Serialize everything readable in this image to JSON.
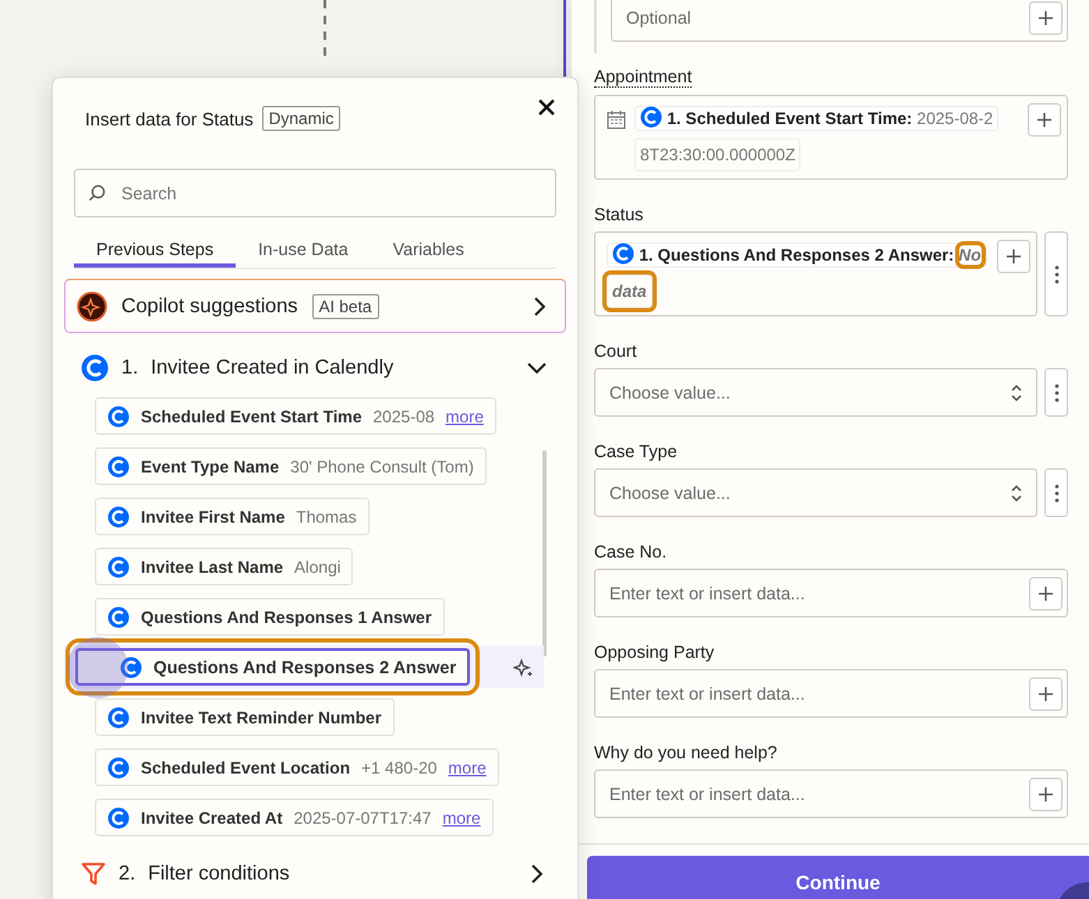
{
  "popup": {
    "title": "Insert data for Status",
    "badge": "Dynamic",
    "search": {
      "placeholder": "Search"
    },
    "tabs": [
      {
        "label": "Previous Steps",
        "selected": true
      },
      {
        "label": "In-use Data",
        "selected": false
      },
      {
        "label": "Variables",
        "selected": false
      }
    ],
    "copilot": {
      "title": "Copilot suggestions",
      "badge": "AI beta"
    },
    "steps": [
      {
        "kind": "calendly",
        "number": "1.",
        "title": "Invitee Created in Calendly",
        "expanded": true,
        "items": [
          {
            "label": "Scheduled Event Start Time",
            "value": "2025-08",
            "link": "more",
            "selected": false
          },
          {
            "label": "Event Type Name",
            "value": "30' Phone Consult (Tom)",
            "selected": false
          },
          {
            "label": "Invitee First Name",
            "value": "Thomas",
            "selected": false
          },
          {
            "label": "Invitee Last Name",
            "value": "Alongi",
            "selected": false
          },
          {
            "label": "Questions And Responses 1 Answer",
            "selected": false
          },
          {
            "label": "Questions And Responses 2 Answer",
            "selected": true
          },
          {
            "label": "Invitee Text Reminder Number",
            "selected": false
          },
          {
            "label": "Scheduled Event Location",
            "value": "+1 480-20",
            "link": "more",
            "selected": false
          },
          {
            "label": "Invitee Created At",
            "value": "2025-07-07T17:47",
            "link": "more",
            "selected": false
          }
        ]
      },
      {
        "kind": "filter",
        "number": "2.",
        "title": "Filter conditions",
        "expanded": false
      }
    ]
  },
  "form": {
    "fields": [
      {
        "kind": "input",
        "placeholder": "Optional",
        "menu": false
      },
      {
        "kind": "token",
        "label": "Appointment",
        "underlined": true,
        "calendar": true,
        "token": "1. Scheduled Event Start Time:",
        "value_parts": [
          {
            "text": "2025-08-2",
            "highlighted": false
          },
          {
            "text": "8T23:30:00.000000Z",
            "highlighted": false
          }
        ],
        "italic": false,
        "menu": false
      },
      {
        "kind": "token",
        "label": "Status",
        "underlined": false,
        "calendar": false,
        "token": "1. Questions And Responses 2 Answer:",
        "value_parts": [
          {
            "text": "No",
            "highlighted": true
          },
          {
            "text": "data",
            "highlighted": true
          }
        ],
        "italic": true,
        "menu": true
      },
      {
        "kind": "select",
        "label": "Court",
        "underlined": false,
        "placeholder": "Choose value...",
        "menu": true
      },
      {
        "kind": "select",
        "label": "Case Type",
        "underlined": false,
        "placeholder": "Choose value...",
        "menu": true
      },
      {
        "kind": "input",
        "label": "Case No.",
        "underlined": false,
        "placeholder": "Enter text or insert data...",
        "menu": false
      },
      {
        "kind": "input",
        "label": "Opposing Party",
        "underlined": false,
        "placeholder": "Enter text or insert data...",
        "menu": false
      },
      {
        "kind": "input",
        "label": "Why do you need help?",
        "underlined": false,
        "placeholder": "Enter text or insert data...",
        "menu": false
      }
    ],
    "button": "Continue"
  }
}
